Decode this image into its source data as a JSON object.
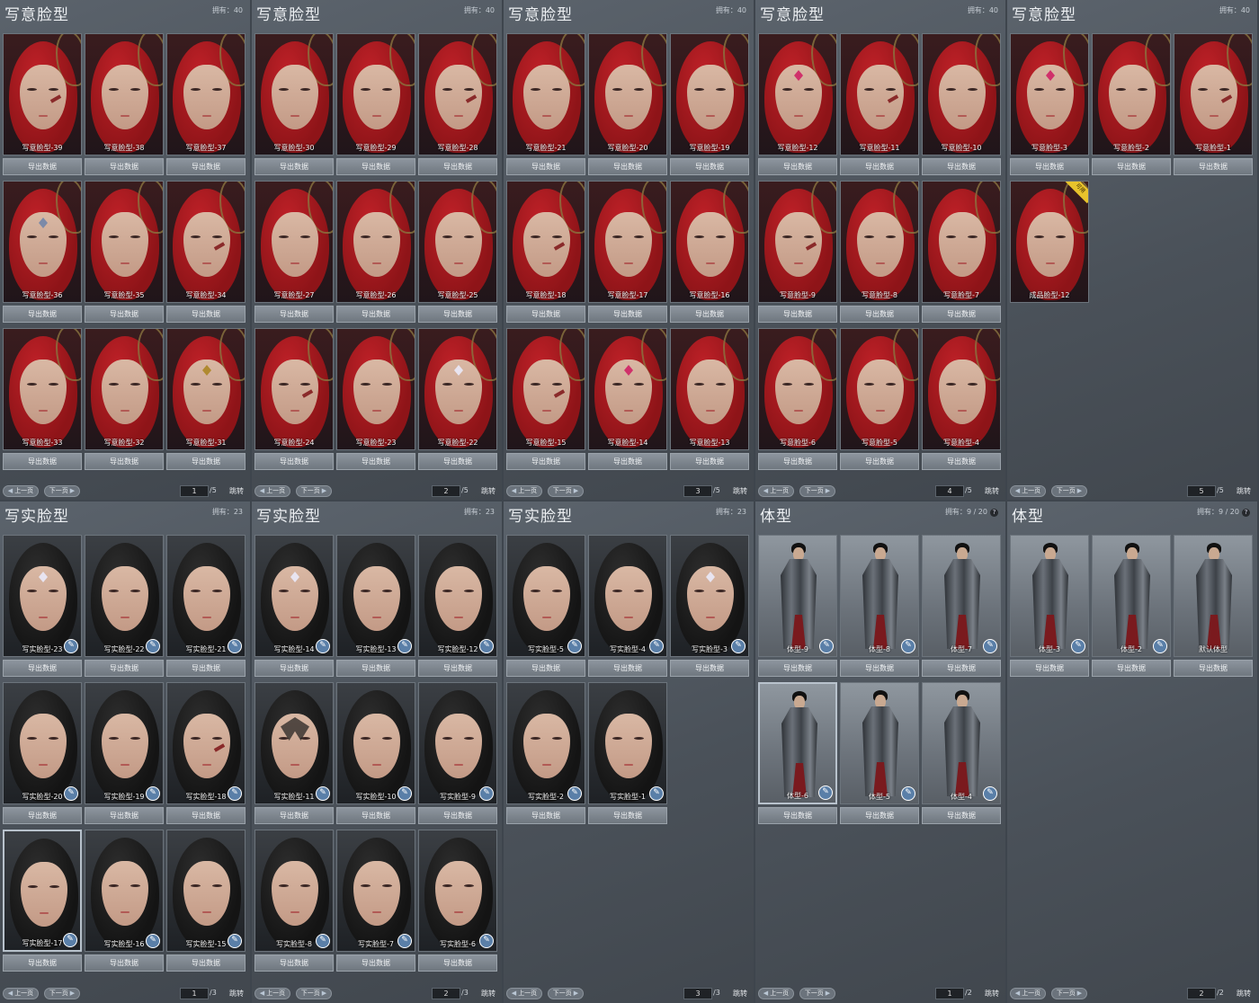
{
  "panels": [
    {
      "title": "写意脸型",
      "count_label": "拥有：",
      "count": "40",
      "page": "1",
      "total": "/5",
      "cards": [
        {
          "name": "写意脸型-39",
          "btn": "导出数据",
          "style": "red",
          "mark": "scar"
        },
        {
          "name": "写意脸型-38",
          "btn": "导出数据",
          "style": "red"
        },
        {
          "name": "写意脸型-37",
          "btn": "导出数据",
          "style": "red"
        },
        {
          "name": "写意脸型-36",
          "btn": "导出数据",
          "style": "red",
          "mark": "jewel"
        },
        {
          "name": "写意脸型-35",
          "btn": "导出数据",
          "style": "red"
        },
        {
          "name": "写意脸型-34",
          "btn": "导出数据",
          "style": "red",
          "mark": "scar"
        },
        {
          "name": "写意脸型-33",
          "btn": "导出数据",
          "style": "red"
        },
        {
          "name": "写意脸型-32",
          "btn": "导出数据",
          "style": "red"
        },
        {
          "name": "写意脸型-31",
          "btn": "导出数据",
          "style": "red",
          "mark": "gold"
        }
      ]
    },
    {
      "title": "写意脸型",
      "count_label": "拥有：",
      "count": "40",
      "page": "2",
      "total": "/5",
      "cards": [
        {
          "name": "写意脸型-30",
          "btn": "导出数据",
          "style": "red"
        },
        {
          "name": "写意脸型-29",
          "btn": "导出数据",
          "style": "red"
        },
        {
          "name": "写意脸型-28",
          "btn": "导出数据",
          "style": "red",
          "mark": "scar"
        },
        {
          "name": "写意脸型-27",
          "btn": "导出数据",
          "style": "red"
        },
        {
          "name": "写意脸型-26",
          "btn": "导出数据",
          "style": "red"
        },
        {
          "name": "写意脸型-25",
          "btn": "导出数据",
          "style": "red"
        },
        {
          "name": "写意脸型-24",
          "btn": "导出数据",
          "style": "red",
          "mark": "scar"
        },
        {
          "name": "写意脸型-23",
          "btn": "导出数据",
          "style": "red"
        },
        {
          "name": "写意脸型-22",
          "btn": "导出数据",
          "style": "red",
          "mark": "white"
        }
      ]
    },
    {
      "title": "写意脸型",
      "count_label": "拥有：",
      "count": "40",
      "page": "3",
      "total": "/5",
      "cards": [
        {
          "name": "写意脸型-21",
          "btn": "导出数据",
          "style": "red"
        },
        {
          "name": "写意脸型-20",
          "btn": "导出数据",
          "style": "red"
        },
        {
          "name": "写意脸型-19",
          "btn": "导出数据",
          "style": "red"
        },
        {
          "name": "写意脸型-18",
          "btn": "导出数据",
          "style": "red",
          "mark": "scar"
        },
        {
          "name": "写意脸型-17",
          "btn": "导出数据",
          "style": "red"
        },
        {
          "name": "写意脸型-16",
          "btn": "导出数据",
          "style": "red"
        },
        {
          "name": "写意脸型-15",
          "btn": "导出数据",
          "style": "red",
          "mark": "scar"
        },
        {
          "name": "写意脸型-14",
          "btn": "导出数据",
          "style": "red",
          "mark": "pink"
        },
        {
          "name": "写意脸型-13",
          "btn": "导出数据",
          "style": "red"
        }
      ]
    },
    {
      "title": "写意脸型",
      "count_label": "拥有：",
      "count": "40",
      "page": "4",
      "total": "/5",
      "cards": [
        {
          "name": "写意脸型-12",
          "btn": "导出数据",
          "style": "red",
          "mark": "pink"
        },
        {
          "name": "写意脸型-11",
          "btn": "导出数据",
          "style": "red",
          "mark": "scar"
        },
        {
          "name": "写意脸型-10",
          "btn": "导出数据",
          "style": "red"
        },
        {
          "name": "写意脸型-9",
          "btn": "导出数据",
          "style": "red",
          "mark": "scar"
        },
        {
          "name": "写意脸型-8",
          "btn": "导出数据",
          "style": "red"
        },
        {
          "name": "写意脸型-7",
          "btn": "导出数据",
          "style": "red"
        },
        {
          "name": "写意脸型-6",
          "btn": "导出数据",
          "style": "red"
        },
        {
          "name": "写意脸型-5",
          "btn": "导出数据",
          "style": "red"
        },
        {
          "name": "写意脸型-4",
          "btn": "导出数据",
          "style": "red"
        }
      ]
    },
    {
      "title": "写意脸型",
      "count_label": "拥有：",
      "count": "40",
      "page": "5",
      "total": "/5",
      "cards": [
        {
          "name": "写意脸型-3",
          "btn": "导出数据",
          "style": "red",
          "mark": "pink"
        },
        {
          "name": "写意脸型-2",
          "btn": "导出数据",
          "style": "red"
        },
        {
          "name": "写意脸型-1",
          "btn": "导出数据",
          "style": "red",
          "mark": "scar"
        },
        {
          "name": "成品脸型-12",
          "style": "red",
          "badge": "可用",
          "nobtn": true
        }
      ]
    },
    {
      "title": "写实脸型",
      "count_label": "拥有：",
      "count": "23",
      "page": "1",
      "total": "/3",
      "cards": [
        {
          "name": "写实脸型-23",
          "btn": "导出数据",
          "style": "black",
          "mark": "white",
          "icon": true
        },
        {
          "name": "写实脸型-22",
          "btn": "导出数据",
          "style": "black",
          "icon": true
        },
        {
          "name": "写实脸型-21",
          "btn": "导出数据",
          "style": "black",
          "icon": true
        },
        {
          "name": "写实脸型-20",
          "btn": "导出数据",
          "style": "black",
          "icon": true
        },
        {
          "name": "写实脸型-19",
          "btn": "导出数据",
          "style": "black",
          "icon": true
        },
        {
          "name": "写实脸型-18",
          "btn": "导出数据",
          "style": "black",
          "mark": "scar",
          "icon": true
        },
        {
          "name": "写实脸型-17",
          "btn": "导出数据",
          "style": "black",
          "icon": true,
          "selected": true
        },
        {
          "name": "写实脸型-16",
          "btn": "导出数据",
          "style": "black",
          "icon": true
        },
        {
          "name": "写实脸型-15",
          "btn": "导出数据",
          "style": "black",
          "icon": true
        }
      ]
    },
    {
      "title": "写实脸型",
      "count_label": "拥有：",
      "count": "23",
      "page": "2",
      "total": "/3",
      "cards": [
        {
          "name": "写实脸型-14",
          "btn": "导出数据",
          "style": "black",
          "mark": "white",
          "icon": true
        },
        {
          "name": "写实脸型-13",
          "btn": "导出数据",
          "style": "black",
          "icon": true
        },
        {
          "name": "写实脸型-12",
          "btn": "导出数据",
          "style": "black",
          "icon": true
        },
        {
          "name": "写实脸型-11",
          "btn": "导出数据",
          "style": "black",
          "mark": "tattoo",
          "icon": true
        },
        {
          "name": "写实脸型-10",
          "btn": "导出数据",
          "style": "black",
          "icon": true
        },
        {
          "name": "写实脸型-9",
          "btn": "导出数据",
          "style": "black",
          "icon": true
        },
        {
          "name": "写实脸型-8",
          "btn": "导出数据",
          "style": "black",
          "icon": true
        },
        {
          "name": "写实脸型-7",
          "btn": "导出数据",
          "style": "black",
          "icon": true
        },
        {
          "name": "写实脸型-6",
          "btn": "导出数据",
          "style": "black",
          "icon": true
        }
      ]
    },
    {
      "title": "写实脸型",
      "count_label": "拥有：",
      "count": "23",
      "page": "3",
      "total": "/3",
      "cards": [
        {
          "name": "写实脸型-5",
          "btn": "导出数据",
          "style": "black",
          "icon": true
        },
        {
          "name": "写实脸型-4",
          "btn": "导出数据",
          "style": "black",
          "icon": true
        },
        {
          "name": "写实脸型-3",
          "btn": "导出数据",
          "style": "black",
          "mark": "white",
          "icon": true
        },
        {
          "name": "写实脸型-2",
          "btn": "导出数据",
          "style": "black",
          "icon": true
        },
        {
          "name": "写实脸型-1",
          "btn": "导出数据",
          "style": "black",
          "icon": true
        }
      ]
    },
    {
      "title": "体型",
      "count_label": "拥有：",
      "count": "9 / 20",
      "page": "1",
      "total": "/2",
      "help": "?",
      "cards": [
        {
          "name": "体型-9",
          "btn": "导出数据",
          "style": "body",
          "icon": true
        },
        {
          "name": "体型-8",
          "btn": "导出数据",
          "style": "body",
          "icon": true
        },
        {
          "name": "体型-7",
          "btn": "导出数据",
          "style": "body",
          "icon": true
        },
        {
          "name": "体型-6",
          "btn": "导出数据",
          "style": "body",
          "icon": true,
          "selected": true
        },
        {
          "name": "体型-5",
          "btn": "导出数据",
          "style": "body",
          "icon": true
        },
        {
          "name": "体型-4",
          "btn": "导出数据",
          "style": "body",
          "icon": true
        }
      ]
    },
    {
      "title": "体型",
      "count_label": "拥有：",
      "count": "9 / 20",
      "page": "2",
      "total": "/2",
      "help": "?",
      "cards": [
        {
          "name": "体型-3",
          "btn": "导出数据",
          "style": "body",
          "icon": true
        },
        {
          "name": "体型-2",
          "btn": "导出数据",
          "style": "body",
          "icon": true
        },
        {
          "name": "默认体型",
          "btn": "导出数据",
          "style": "body"
        }
      ]
    }
  ],
  "pager": {
    "prev": "上一页",
    "next": "下一页",
    "jump": "跳转"
  },
  "colors": {
    "red_hair": "#8e1418",
    "black_hair": "#141414",
    "skin": "#d9b8a4",
    "button": "#7d858d",
    "panel": "#4f565e",
    "icon": "#5a7fa8"
  },
  "icons": {
    "edit": "brush-icon",
    "prev": "arrow-left-icon",
    "next": "arrow-right-icon",
    "help": "question-icon"
  }
}
